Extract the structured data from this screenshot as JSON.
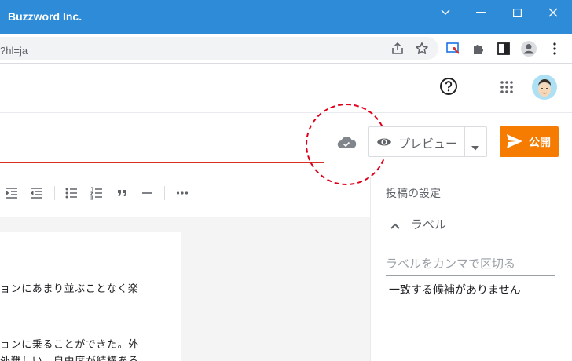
{
  "window": {
    "title": "Buzzword Inc."
  },
  "browser": {
    "url": "?hl=ja"
  },
  "editor": {
    "preview_label": "プレビュー",
    "publish_label": "公開",
    "paragraphs": [
      "ョンにあまり並ぶことなく楽",
      "ョンに乗ることができた。外",
      "外難しい。自由度が結構ある"
    ]
  },
  "settings": {
    "title": "投稿の設定",
    "labels_section": "ラベル",
    "labels_placeholder": "ラベルをカンマで区切る",
    "no_match": "一致する候補がありません"
  },
  "colors": {
    "titlebar": "#2e8bd8",
    "publish": "#f57c00",
    "title_underline": "#d93025",
    "annotation_circle": "#e0001b"
  }
}
